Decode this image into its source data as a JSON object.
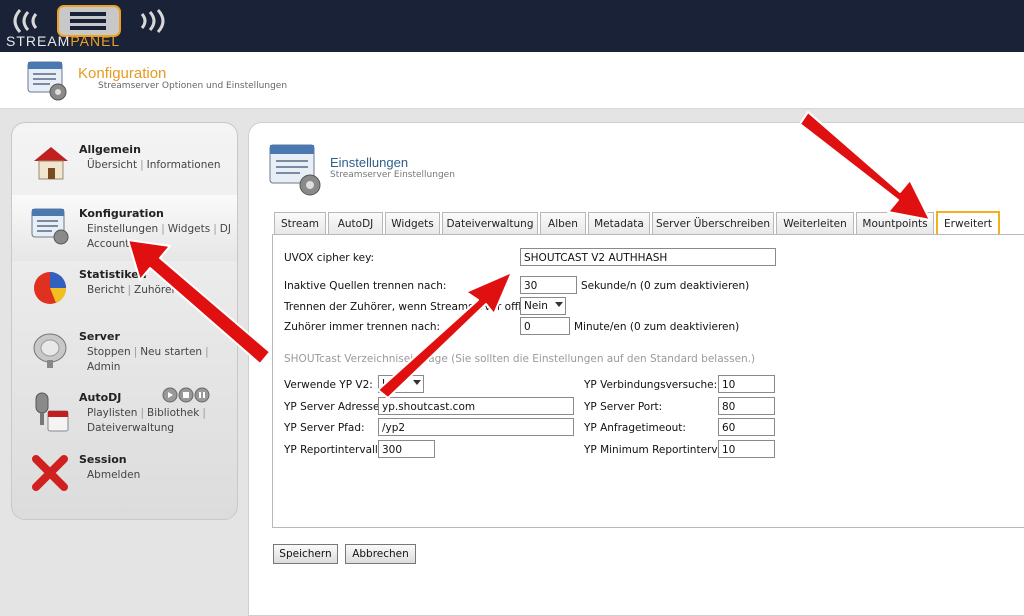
{
  "brand": {
    "logo_text_a": "STREAM",
    "logo_text_b": "PANEL"
  },
  "header": {
    "title": "Konfiguration",
    "subtitle": "Streamserver Optionen und Einstellungen"
  },
  "sidebar": {
    "sections": [
      {
        "title": "Allgemein",
        "links": [
          "Übersicht",
          "Informationen"
        ]
      },
      {
        "title": "Konfiguration",
        "links": [
          "Einstellungen",
          "Widgets",
          "DJ",
          "Accounts"
        ]
      },
      {
        "title": "Statistiken",
        "links": [
          "Bericht",
          "Zuhörer",
          "L"
        ]
      },
      {
        "title": "Server",
        "links": [
          "Stoppen",
          "Neu starten",
          "Admin"
        ]
      },
      {
        "title": "AutoDJ",
        "links": [
          "Playlisten",
          "Bibliothek",
          "Dateiverwaltung"
        ]
      },
      {
        "title": "Session",
        "links": [
          "Abmelden"
        ]
      }
    ]
  },
  "content": {
    "title": "Einstellungen",
    "subtitle": "Streamserver Einstellungen"
  },
  "tabs": [
    "Stream",
    "AutoDJ",
    "Widgets",
    "Dateiverwaltung",
    "Alben",
    "Metadata",
    "Server Überschreiben",
    "Weiterleiten",
    "Mountpoints",
    "Erweitert"
  ],
  "form": {
    "uvox_label": "UVOX cipher key:",
    "uvox_value": "SHOUTCAST V2 AUTHHASH",
    "inactive_label": "Inaktive Quellen trennen nach:",
    "inactive_value": "30",
    "inactive_unit": "Sekunde/n (0 zum deaktivieren)",
    "disconnect_label": "Trennen der Zuhörer, wenn Streamserver offline:",
    "disconnect_value": "Nein",
    "always_label": "Zuhörer immer trennen nach:",
    "always_value": "0",
    "always_unit": "Minute/en (0 zum deaktivieren)",
    "section_heading": "SHOUTcast Verzeichniseinträge (Sie sollten die Einstellungen auf den Standard belassen.)",
    "yp_v2_label": "Verwende YP V2:",
    "yp_v2_value": "Ja",
    "yp_addr_label": "YP Server Adresse:",
    "yp_addr_value": "yp.shoutcast.com",
    "yp_path_label": "YP Server Pfad:",
    "yp_path_value": "/yp2",
    "yp_report_label": "YP Reportintervall:",
    "yp_report_value": "300",
    "yp_retries_label": "YP Verbindungsversuche:",
    "yp_retries_value": "10",
    "yp_port_label": "YP Server Port:",
    "yp_port_value": "80",
    "yp_timeout_label": "YP Anfragetimeout:",
    "yp_timeout_value": "60",
    "yp_minreport_label": "YP Minimum Reportintervall:",
    "yp_minreport_value": "10"
  },
  "buttons": {
    "save": "Speichern",
    "cancel": "Abbrechen"
  },
  "colors": {
    "topbar": "#1a2238",
    "accent": "#e69a1f",
    "arrow": "#e01010"
  },
  "icons": [
    "streampanel-logo",
    "config-window-icon",
    "home-icon",
    "statistics-pie-icon",
    "server-satellite-icon",
    "autodj-microphone-icon",
    "session-close-icon",
    "play-control-icons",
    "red-annotation-arrow"
  ]
}
